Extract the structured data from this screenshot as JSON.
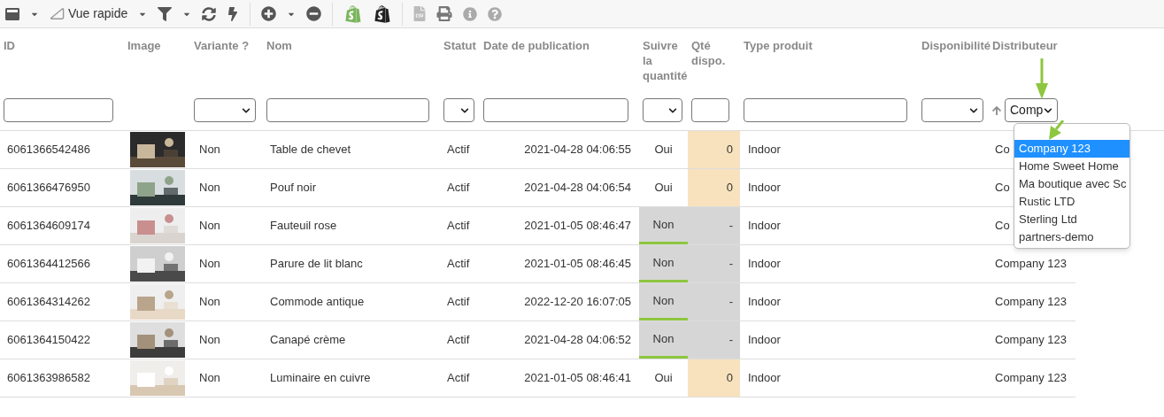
{
  "toolbar": {
    "view_label": "Vue rapide"
  },
  "columns": [
    {
      "label": "ID",
      "filter": {
        "kind": "text"
      }
    },
    {
      "label": "Image",
      "filter": {
        "kind": "none"
      }
    },
    {
      "label": "Variante ?",
      "filter": {
        "kind": "select"
      }
    },
    {
      "label": "Nom",
      "filter": {
        "kind": "text"
      }
    },
    {
      "label": "Statut",
      "filter": {
        "kind": "select"
      }
    },
    {
      "label": "Date de publication",
      "filter": {
        "kind": "text"
      }
    },
    {
      "label": "Suivre la quantité",
      "filter": {
        "kind": "select"
      }
    },
    {
      "label": "Qté dispo.",
      "filter": {
        "kind": "text"
      }
    },
    {
      "label": "Type produit",
      "filter": {
        "kind": "text"
      }
    },
    {
      "label": "Disponibilité",
      "filter": {
        "kind": "select"
      }
    },
    {
      "label": "Distributeur",
      "filter": {
        "kind": "select",
        "value": "Comp",
        "sorted": true
      }
    }
  ],
  "rows": [
    {
      "id": "6061366542486",
      "variant": "Non",
      "name": "Table de chevet",
      "status": "Actif",
      "date": "2021-04-28 04:06:55",
      "tracked": true,
      "track": "Oui",
      "quantity": "0",
      "type": "Indoor",
      "distributor": "Co"
    },
    {
      "id": "6061366476950",
      "variant": "Non",
      "name": "Pouf noir",
      "status": "Actif",
      "date": "2021-04-28 04:06:54",
      "tracked": true,
      "track": "Oui",
      "quantity": "0",
      "type": "Indoor",
      "distributor": "Co"
    },
    {
      "id": "6061364609174",
      "variant": "Non",
      "name": "Fauteuil rose",
      "status": "Actif",
      "date": "2021-01-05 08:46:47",
      "tracked": false,
      "track": "Non",
      "quantity": "-",
      "type": "Indoor",
      "distributor": "Co"
    },
    {
      "id": "6061364412566",
      "variant": "Non",
      "name": "Parure de lit blanc",
      "status": "Actif",
      "date": "2021-01-05 08:46:45",
      "tracked": false,
      "track": "Non",
      "quantity": "-",
      "type": "Indoor",
      "distributor": "Company 123"
    },
    {
      "id": "6061364314262",
      "variant": "Non",
      "name": "Commode antique",
      "status": "Actif",
      "date": "2022-12-20 16:07:05",
      "tracked": false,
      "track": "Non",
      "quantity": "-",
      "type": "Indoor",
      "distributor": "Company 123"
    },
    {
      "id": "6061364150422",
      "variant": "Non",
      "name": "Canapé crème",
      "status": "Actif",
      "date": "2021-04-28 04:06:52",
      "tracked": false,
      "track": "Non",
      "quantity": "-",
      "type": "Indoor",
      "distributor": "Company 123"
    },
    {
      "id": "6061363986582",
      "variant": "Non",
      "name": "Luminaire en cuivre",
      "status": "Actif",
      "date": "2021-01-05 08:46:41",
      "tracked": true,
      "track": "Oui",
      "quantity": "0",
      "type": "Indoor",
      "distributor": "Company 123"
    }
  ],
  "dropdown": {
    "options": [
      {
        "label": "Company 123",
        "selected": true
      },
      {
        "label": "Home Sweet Home",
        "selected": false
      },
      {
        "label": "Ma boutique avec Sc",
        "selected": false
      },
      {
        "label": "Rustic LTD",
        "selected": false
      },
      {
        "label": "Sterling Ltd",
        "selected": false
      },
      {
        "label": "partners-demo",
        "selected": false
      }
    ]
  }
}
